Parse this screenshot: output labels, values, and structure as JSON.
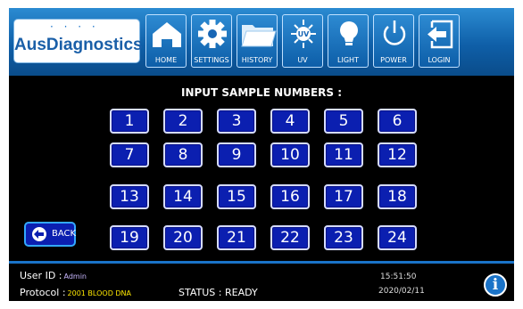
{
  "brand": {
    "name": "AusDiagnostics",
    "dots": "· · · ·"
  },
  "nav": [
    {
      "id": "home",
      "label": "HOME",
      "icon": "home-icon"
    },
    {
      "id": "settings",
      "label": "SETTINGS",
      "icon": "gear-icon"
    },
    {
      "id": "history",
      "label": "HISTORY",
      "icon": "folder-icon"
    },
    {
      "id": "uv",
      "label": "UV",
      "icon": "uv-lamp-icon"
    },
    {
      "id": "light",
      "label": "LIGHT",
      "icon": "lightbulb-icon"
    },
    {
      "id": "power",
      "label": "POWER",
      "icon": "power-icon"
    },
    {
      "id": "login",
      "label": "LOGIN",
      "icon": "login-icon"
    }
  ],
  "uv_badge": "UV",
  "prompt": "INPUT SAMPLE NUMBERS :",
  "numbers": [
    "1",
    "2",
    "3",
    "4",
    "5",
    "6",
    "7",
    "8",
    "9",
    "10",
    "11",
    "12",
    "13",
    "14",
    "15",
    "16",
    "17",
    "18",
    "19",
    "20",
    "21",
    "22",
    "23",
    "24"
  ],
  "back_label": "BACK",
  "footer": {
    "user_label": "User ID :",
    "user_value": "Admin",
    "protocol_label": "Protocol :",
    "protocol_value": "2001 BLOOD DNA",
    "status_text": "STATUS : READY",
    "time": "15:51:50",
    "date": "2020/02/11",
    "info_glyph": "i"
  },
  "colors": {
    "topbar": "#1a73c8",
    "button": "#0b1fb0",
    "highlight": "#ffe800",
    "background": "#000000"
  }
}
